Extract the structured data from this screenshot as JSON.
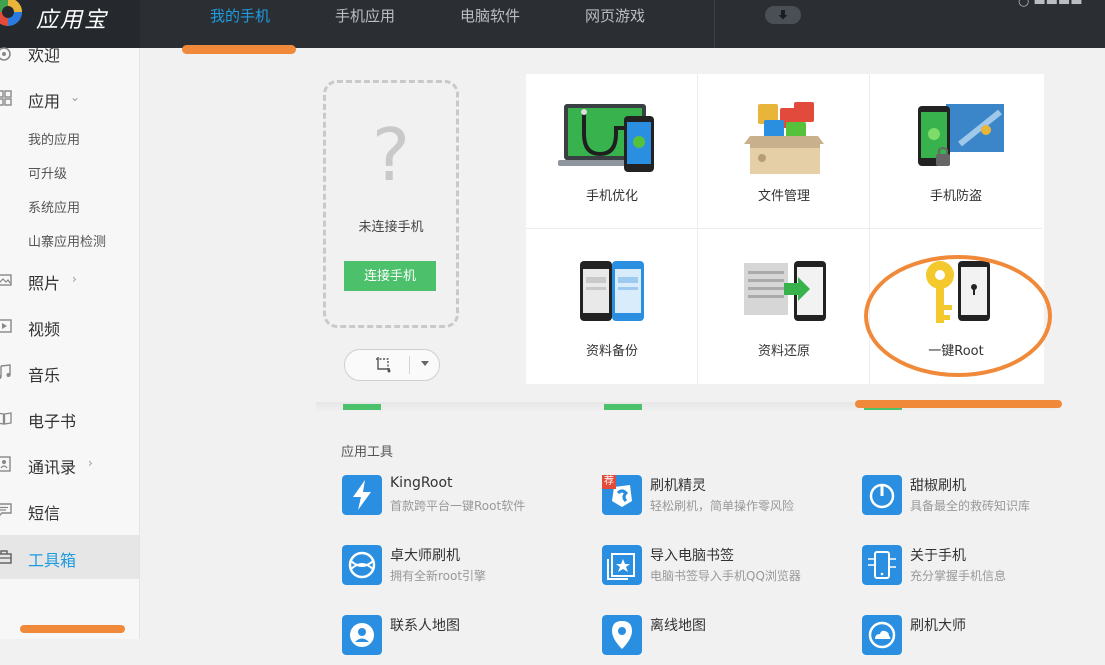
{
  "header": {
    "app_name": "应用宝",
    "tabs": [
      {
        "label": "我的手机",
        "active": true
      },
      {
        "label": "手机应用",
        "active": false
      },
      {
        "label": "电脑软件",
        "active": false
      },
      {
        "label": "网页游戏",
        "active": false
      }
    ],
    "right_text": "○  ▬▬▬▬"
  },
  "sidebar": {
    "items": [
      {
        "label": "欢迎"
      },
      {
        "label": "应用",
        "chevron": "⌄"
      },
      {
        "label": "照片",
        "chevron": "›"
      },
      {
        "label": "视频"
      },
      {
        "label": "音乐"
      },
      {
        "label": "电子书"
      },
      {
        "label": "通讯录",
        "chevron": "›"
      },
      {
        "label": "短信"
      },
      {
        "label": "工具箱",
        "active": true
      }
    ],
    "sub_items": [
      "我的应用",
      "可升级",
      "系统应用",
      "山寨应用检测"
    ]
  },
  "phone_panel": {
    "placeholder_glyph": "?",
    "status": "未连接手机",
    "connect_label": "连接手机"
  },
  "tools": [
    {
      "label": "手机优化",
      "icon": "stethoscope-phone-icon"
    },
    {
      "label": "文件管理",
      "icon": "file-box-icon"
    },
    {
      "label": "手机防盗",
      "icon": "phone-lock-icon"
    },
    {
      "label": "资料备份",
      "icon": "backup-phones-icon"
    },
    {
      "label": "资料还原",
      "icon": "restore-arrow-icon"
    },
    {
      "label": "一键Root",
      "icon": "key-phone-icon"
    }
  ],
  "app_tools": {
    "title": "应用工具",
    "items": [
      {
        "name": "KingRoot",
        "desc": "首款跨平台一键Root软件",
        "color": "#2a8fe0"
      },
      {
        "name": "刷机精灵",
        "desc": "轻松刷机，简单操作零风险",
        "color": "#2a8fe0",
        "badge": "荐"
      },
      {
        "name": "甜椒刷机",
        "desc": "具备最全的救砖知识库",
        "color": "#2a8fe0"
      },
      {
        "name": "卓大师刷机",
        "desc": "拥有全新root引擎",
        "color": "#2a8fe0"
      },
      {
        "name": "导入电脑书签",
        "desc": "电脑书签导入手机QQ浏览器",
        "color": "#2a8fe0"
      },
      {
        "name": "关于手机",
        "desc": "充分掌握手机信息",
        "color": "#2a8fe0"
      },
      {
        "name": "联系人地图",
        "desc": "",
        "color": "#2a8fe0"
      },
      {
        "name": "离线地图",
        "desc": "",
        "color": "#2a8fe0"
      },
      {
        "name": "刷机大师",
        "desc": "",
        "color": "#2a8fe0"
      }
    ]
  },
  "colors": {
    "accent": "#1f9be0",
    "annotation": "#f08a3a",
    "connect_green": "#4cc06b",
    "topbar": "#2b2f33"
  }
}
